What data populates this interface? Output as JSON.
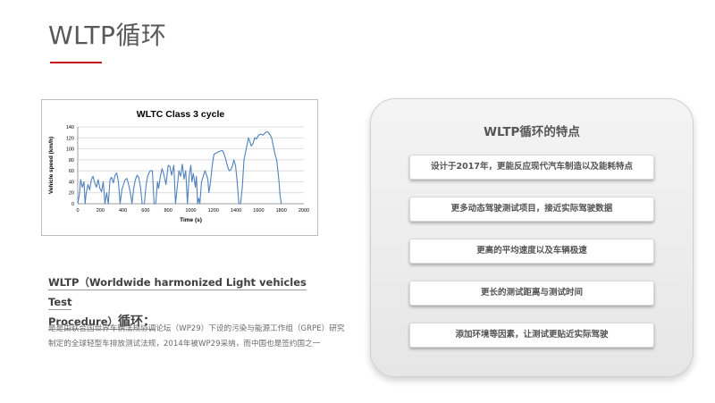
{
  "title": "WLTP循环",
  "chart_data": {
    "type": "line",
    "title": "WLTC Class 3 cycle",
    "xlabel": "Time (s)",
    "ylabel": "Vehicle speed (km/h)",
    "xlim": [
      0,
      2000
    ],
    "ylim": [
      0,
      140
    ],
    "xticks": [
      "0",
      "200",
      "400",
      "600",
      "800",
      "1000",
      "1200",
      "1400",
      "1600",
      "1800",
      "2000"
    ],
    "yticks": [
      "0",
      "20",
      "40",
      "60",
      "80",
      "100",
      "120",
      "140"
    ],
    "grid": true,
    "series": [
      {
        "color": "#4f81bd",
        "x": [
          0,
          15,
          25,
          40,
          55,
          65,
          75,
          90,
          105,
          120,
          135,
          150,
          165,
          180,
          195,
          210,
          225,
          240,
          255,
          270,
          285,
          300,
          315,
          330,
          345,
          360,
          375,
          390,
          405,
          420,
          435,
          450,
          465,
          480,
          495,
          510,
          525,
          540,
          555,
          570,
          589,
          605,
          620,
          640,
          660,
          675,
          690,
          705,
          715,
          730,
          745,
          760,
          780,
          800,
          815,
          830,
          850,
          865,
          880,
          895,
          910,
          925,
          940,
          955,
          970,
          985,
          1000,
          1010,
          1022,
          1030,
          1040,
          1050,
          1060,
          1070,
          1080,
          1095,
          1110,
          1125,
          1140,
          1150,
          1160,
          1175,
          1190,
          1205,
          1220,
          1240,
          1260,
          1280,
          1295,
          1310,
          1320,
          1330,
          1340,
          1355,
          1370,
          1380,
          1395,
          1410,
          1425,
          1440,
          1455,
          1470,
          1480,
          1490,
          1500,
          1510,
          1520,
          1535,
          1550,
          1565,
          1580,
          1600,
          1620,
          1640,
          1660,
          1680,
          1700,
          1715,
          1730,
          1745,
          1760,
          1770,
          1780,
          1790,
          1800
        ],
        "values": [
          0,
          18,
          44,
          30,
          40,
          0,
          20,
          35,
          25,
          44,
          50,
          38,
          30,
          44,
          28,
          22,
          40,
          0,
          20,
          0,
          44,
          48,
          38,
          52,
          56,
          40,
          0,
          25,
          35,
          44,
          46,
          35,
          20,
          0,
          28,
          44,
          52,
          48,
          30,
          0,
          0,
          35,
          52,
          60,
          60,
          0,
          0,
          40,
          28,
          48,
          64,
          55,
          35,
          70,
          68,
          52,
          70,
          0,
          30,
          60,
          50,
          72,
          45,
          60,
          0,
          50,
          70,
          40,
          55,
          45,
          30,
          50,
          0,
          10,
          0,
          40,
          50,
          60,
          52,
          45,
          20,
          40,
          70,
          90,
          92,
          94,
          96,
          97,
          90,
          80,
          72,
          65,
          60,
          62,
          70,
          80,
          70,
          40,
          0,
          0,
          30,
          80,
          90,
          100,
          110,
          120,
          115,
          105,
          110,
          120,
          118,
          125,
          127,
          125,
          130,
          131,
          126,
          120,
          105,
          90,
          80,
          60,
          40,
          15,
          0
        ]
      }
    ]
  },
  "definition": {
    "heading_line1": "WLTP（Worldwide harmonized Light vehicles Test",
    "heading_line2a": "Procedure）",
    "heading_line2b": "循环：",
    "body": "是是由联合国世界车辆法规协调论坛（WP29）下设的污染与能源工作组（GRPE）研究制定的全球轻型车排放测试法规，2014年被WP29采纳，而中国也是签约国之一"
  },
  "features": {
    "title": "WLTP循环的特点",
    "items": [
      "设计于2017年，更能反应现代汽车制造以及能耗特点",
      "更多动态驾驶测试项目，接近实际驾驶数据",
      "更高的平均速度以及车辆极速",
      "更长的测试距离与测试时间",
      "添加环境等因素，让测试更贴近实际驾驶"
    ]
  }
}
